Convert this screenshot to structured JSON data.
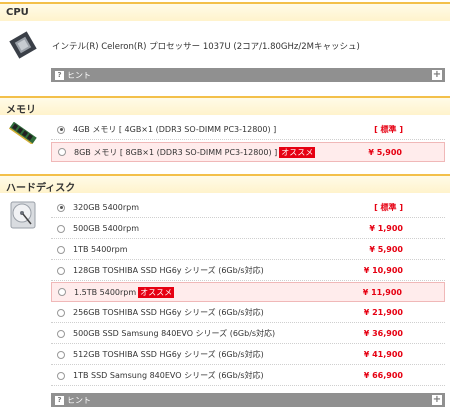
{
  "cpu": {
    "heading": "CPU",
    "description": "インテル(R) Celeron(R) プロセッサー 1037U (2コア/1.80GHz/2Mキャッシュ)",
    "hint_label": "ヒント",
    "hint_q": "?",
    "hint_plus": "+"
  },
  "memory": {
    "heading": "メモリ",
    "options": [
      {
        "label": "4GB メモリ [ 4GB×1 (DDR3 SO-DIMM PC3-12800) ]",
        "badge": "",
        "price": "[ 標準 ]",
        "selected": true,
        "highlight": false
      },
      {
        "label": "8GB メモリ [ 8GB×1 (DDR3 SO-DIMM PC3-12800) ]",
        "badge": "オススメ",
        "price": "¥ 5,900",
        "selected": false,
        "highlight": true
      }
    ]
  },
  "hdd": {
    "heading": "ハードディスク",
    "hint_label": "ヒント",
    "hint_q": "?",
    "hint_plus": "+",
    "options": [
      {
        "label": "320GB 5400rpm",
        "badge": "",
        "price": "[ 標準 ]",
        "selected": true,
        "highlight": false
      },
      {
        "label": "500GB 5400rpm",
        "badge": "",
        "price": "¥ 1,900",
        "selected": false,
        "highlight": false
      },
      {
        "label": "1TB 5400rpm",
        "badge": "",
        "price": "¥ 5,900",
        "selected": false,
        "highlight": false
      },
      {
        "label": "128GB TOSHIBA SSD HG6y シリーズ (6Gb/s対応)",
        "badge": "",
        "price": "¥ 10,900",
        "selected": false,
        "highlight": false
      },
      {
        "label": "1.5TB 5400rpm",
        "badge": "オススメ",
        "price": "¥ 11,900",
        "selected": false,
        "highlight": true
      },
      {
        "label": "256GB TOSHIBA SSD HG6y シリーズ (6Gb/s対応)",
        "badge": "",
        "price": "¥ 21,900",
        "selected": false,
        "highlight": false
      },
      {
        "label": "500GB SSD Samsung 840EVO シリーズ (6Gb/s対応)",
        "badge": "",
        "price": "¥ 36,900",
        "selected": false,
        "highlight": false
      },
      {
        "label": "512GB TOSHIBA SSD HG6y シリーズ (6Gb/s対応)",
        "badge": "",
        "price": "¥ 41,900",
        "selected": false,
        "highlight": false
      },
      {
        "label": "1TB SSD Samsung 840EVO シリーズ (6Gb/s対応)",
        "badge": "",
        "price": "¥ 66,900",
        "selected": false,
        "highlight": false
      }
    ]
  },
  "colors": {
    "accent_red": "#e60012",
    "header_border": "#f3c04a",
    "hint_bg": "#909090"
  }
}
